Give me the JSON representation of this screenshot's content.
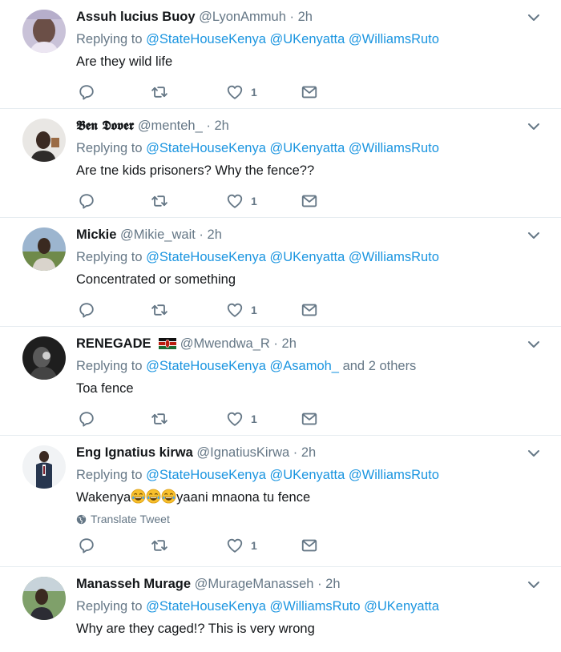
{
  "tweets": [
    {
      "name": "Assuh lucius Buoy",
      "handle": "@LyonAmmuh",
      "time": "2h",
      "replying_prefix": "Replying to",
      "mentions": [
        "@StateHouseKenya",
        "@UKenyatta",
        "@WilliamsRuto"
      ],
      "extra": "",
      "text": "Are they wild life",
      "likes": "1"
    },
    {
      "name": "𝕭𝖊𝖓 𝕯𝖔𝖛𝖊𝖗",
      "handle": "@menteh_",
      "time": "2h",
      "replying_prefix": "Replying to",
      "mentions": [
        "@StateHouseKenya",
        "@UKenyatta",
        "@WilliamsRuto"
      ],
      "extra": "",
      "text": "Are tne kids prisoners? Why the fence??",
      "likes": "1"
    },
    {
      "name": "Mickie",
      "handle": "@Mikie_wait",
      "time": "2h",
      "replying_prefix": "Replying to",
      "mentions": [
        "@StateHouseKenya",
        "@UKenyatta",
        "@WilliamsRuto"
      ],
      "extra": "",
      "text": "Concentrated or something",
      "likes": "1"
    },
    {
      "name": "RENEGADE",
      "handle": "@Mwendwa_R",
      "time": "2h",
      "replying_prefix": "Replying to",
      "mentions": [
        "@StateHouseKenya",
        "@Asamoh_"
      ],
      "extra": "and 2 others",
      "text": "Toa fence",
      "likes": "1"
    },
    {
      "name": "Eng Ignatius kirwa",
      "handle": "@IgnatiusKirwa",
      "time": "2h",
      "replying_prefix": "Replying to",
      "mentions": [
        "@StateHouseKenya",
        "@UKenyatta",
        "@WilliamsRuto"
      ],
      "extra": "",
      "text_before": "Wakenya",
      "text_after": "yaani mnaona tu fence",
      "translate": "Translate Tweet",
      "likes": "1"
    },
    {
      "name": "Manasseh Murage",
      "handle": "@MurageManasseh",
      "time": "2h",
      "replying_prefix": "Replying to",
      "mentions": [
        "@StateHouseKenya",
        "@WilliamsRuto",
        "@UKenyatta"
      ],
      "extra": "",
      "text": "Why are they caged!? This is very wrong"
    }
  ],
  "dot": "·",
  "icons": {
    "reply": "reply-icon",
    "retweet": "retweet-icon",
    "like": "heart-icon",
    "message": "envelope-icon",
    "caret": "chevron-down-icon",
    "globe": "globe-icon",
    "emoji": "laughing-tears-emoji",
    "flag": "kenya-flag"
  },
  "colors": {
    "mention": "#1b95e0",
    "secondary": "#657786",
    "border": "#e6ecf0"
  }
}
